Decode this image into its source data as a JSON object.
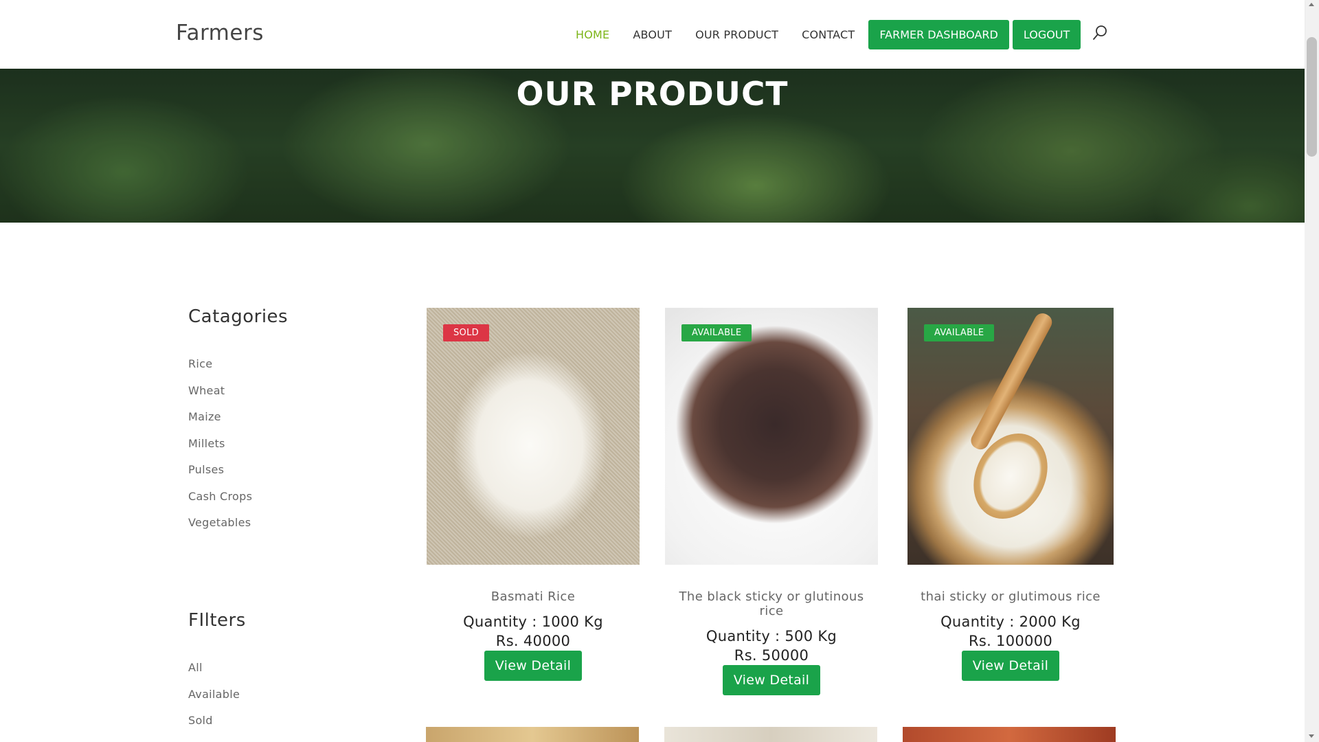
{
  "header": {
    "brand": "Farmers",
    "nav": {
      "home": "HOME",
      "about": "ABOUT",
      "our_product": "OUR PRODUCT",
      "contact": "CONTACT",
      "farmer_dashboard": "FARMER DASHBOARD",
      "logout": "LOGOUT"
    },
    "active_nav": "HOME",
    "accent_color": "#7cb518",
    "button_color": "#1aa34a"
  },
  "hero": {
    "title": "OUR PRODUCT"
  },
  "sidebar": {
    "categories_title": "Catagories",
    "categories": [
      "Rice",
      "Wheat",
      "Maize",
      "Millets",
      "Pulses",
      "Cash Crops",
      "Vegetables"
    ],
    "filters_title": "FIlters",
    "filters": [
      "All",
      "Available",
      "Sold"
    ]
  },
  "products": [
    {
      "badge": "SOLD",
      "badge_color": "#dc3545",
      "name": "Basmati Rice",
      "quantity": "Quantity : 1000 Kg",
      "price": "Rs. 40000",
      "button": "View Detail"
    },
    {
      "badge": "AVAILABLE",
      "badge_color": "#28a745",
      "name": "The black sticky or glutinous rice",
      "quantity": "Quantity : 500 Kg",
      "price": "Rs. 50000",
      "button": "View Detail"
    },
    {
      "badge": "AVAILABLE",
      "badge_color": "#28a745",
      "name": "thai sticky or glutimous rice",
      "quantity": "Quantity : 2000 Kg",
      "price": "Rs. 100000",
      "button": "View Detail"
    }
  ]
}
